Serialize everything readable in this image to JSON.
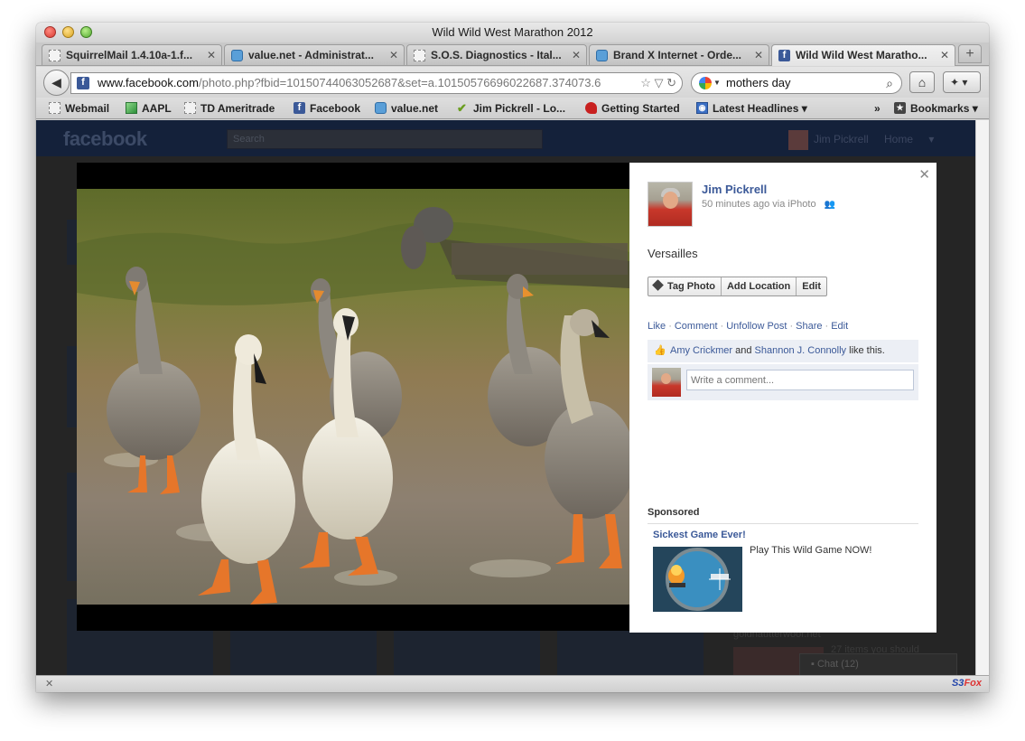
{
  "window": {
    "title": "Wild Wild West Marathon 2012"
  },
  "tabs": [
    {
      "label": "SquirrelMail 1.4.10a-1.f...",
      "icon": "blank"
    },
    {
      "label": "value.net - Administrat...",
      "icon": "ie"
    },
    {
      "label": "S.O.S. Diagnostics - Ital...",
      "icon": "blank"
    },
    {
      "label": "Brand X Internet - Orde...",
      "icon": "ie"
    },
    {
      "label": "Wild Wild West Maratho...",
      "icon": "fb",
      "active": true
    }
  ],
  "navbar": {
    "url_domain": "www.facebook.com",
    "url_path": "/photo.php?fbid=10150744063052687&set=a.10150576696022687.374073.6",
    "search_value": "mothers day"
  },
  "bookmarks": [
    {
      "label": "Webmail",
      "icon": "blank"
    },
    {
      "label": "AAPL",
      "icon": "aapl"
    },
    {
      "label": "TD Ameritrade",
      "icon": "blank"
    },
    {
      "label": "Facebook",
      "icon": "fb"
    },
    {
      "label": "value.net",
      "icon": "ie"
    },
    {
      "label": "Jim Pickrell - Lo...",
      "icon": "check"
    },
    {
      "label": "Getting Started",
      "icon": "gs"
    },
    {
      "label": "Latest Headlines",
      "icon": "rss"
    },
    {
      "label": "Bookmarks",
      "icon": "bkm"
    }
  ],
  "facebook": {
    "logo": "facebook",
    "search_placeholder": "Search",
    "user_name": "Jim Pickrell",
    "home_label": "Home",
    "chat_label": "Chat (12)",
    "bg_text_1": "goldnautterwoor.net",
    "bg_text_2": "27 items you should"
  },
  "photo_panel": {
    "author": "Jim Pickrell",
    "meta": "50 minutes ago via iPhoto",
    "caption": "Versailles",
    "actions": [
      "Tag Photo",
      "Add Location",
      "Edit"
    ],
    "links": [
      "Like",
      "Comment",
      "Unfollow Post",
      "Share",
      "Edit"
    ],
    "likes": {
      "person1": "Amy Crickmer",
      "and": "and",
      "person2": "Shannon J. Connolly",
      "suffix": "like this."
    },
    "comment_placeholder": "Write a comment...",
    "sponsored_label": "Sponsored",
    "ad": {
      "title": "Sickest Game Ever!",
      "text": "Play This Wild Game NOW!"
    }
  },
  "statusbar": {
    "addon": "S3Fox",
    "addon_s3": "S3",
    "addon_fox": "Fox"
  }
}
